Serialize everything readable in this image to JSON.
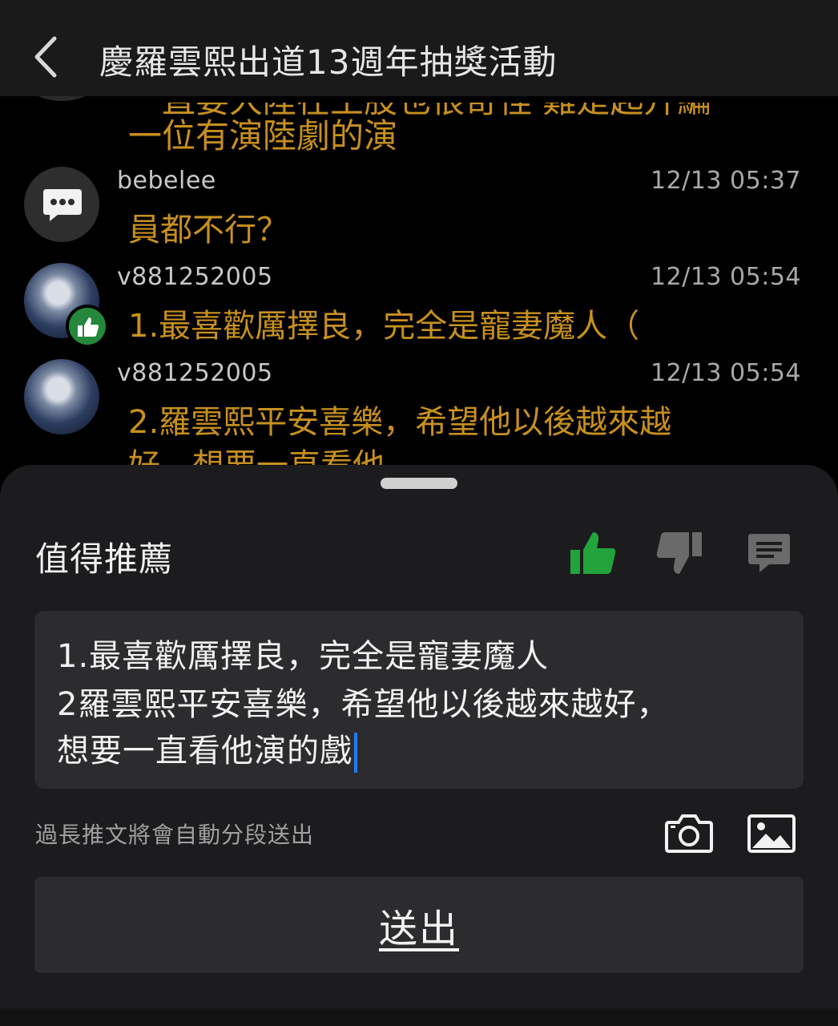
{
  "header": {
    "title": "慶羅雲熙出道13週年抽獎活動"
  },
  "feed": {
    "partial_top_text": "一直要大陸在王股也很奇怪 難是起升編",
    "partial_top_text_2": "一位有演陸劇的演",
    "comments": [
      {
        "user": "bebelee",
        "time": "12/13 05:37",
        "text": "員都不行？",
        "avatar": "chat-bubble-icon"
      },
      {
        "user": "v881252005",
        "time": "12/13 05:54",
        "text": "1.最喜歡厲擇良，完全是寵妻魔人（",
        "avatar": "user-photo",
        "badge": "thumbs-up-icon"
      },
      {
        "user": "v881252005",
        "time": "12/13 05:54",
        "text": "2.羅雲熙平安喜樂，希望他以後越來越",
        "text_2": "好，想要一直看他",
        "avatar": "user-photo"
      }
    ]
  },
  "sheet": {
    "title": "值得推薦",
    "vote_options": [
      "thumbs-up-icon",
      "thumbs-down-icon",
      "comment-icon"
    ],
    "selected_vote": "thumbs-up",
    "editor_lines": [
      "1.最喜歡厲擇良，完全是寵妻魔人",
      "2羅雲熙平安喜樂，希望他以後越來越好，",
      "想要一直看他演的戲"
    ],
    "hint": "過長推文將會自動分段送出",
    "media_buttons": [
      "camera-icon",
      "image-icon"
    ],
    "submit_label": "送出"
  },
  "colors": {
    "background": "#000000",
    "sheet": "#1c1c1e",
    "comment_text": "#c7901f",
    "like_green": "#25873b",
    "caret_blue": "#1e7cf2"
  }
}
